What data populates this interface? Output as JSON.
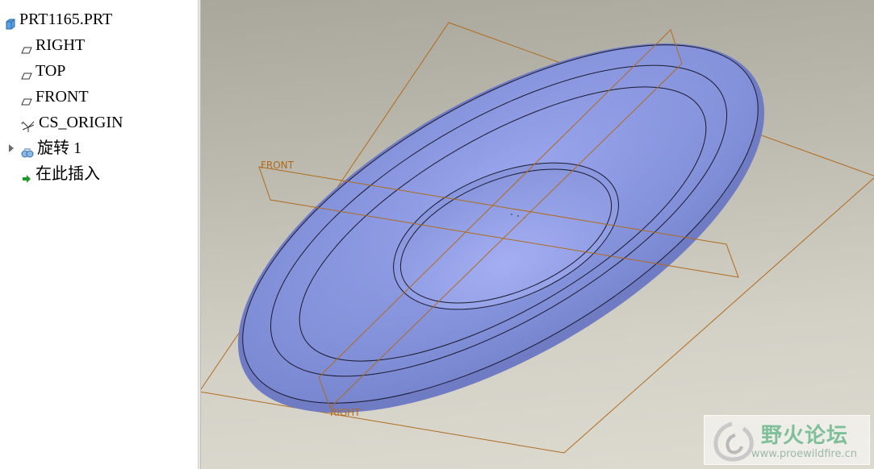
{
  "model_tree": {
    "root": {
      "label": "PRT1165.PRT",
      "icon": "part-icon"
    },
    "items": [
      {
        "label": "RIGHT",
        "icon": "datum-plane-icon"
      },
      {
        "label": "TOP",
        "icon": "datum-plane-icon"
      },
      {
        "label": "FRONT",
        "icon": "datum-plane-icon"
      },
      {
        "label": "CS_ORIGIN",
        "icon": "coordinate-system-icon"
      },
      {
        "label": "旋转 1",
        "icon": "revolve-feature-icon"
      },
      {
        "label": "在此插入",
        "icon": "insert-here-arrow-icon"
      }
    ]
  },
  "viewport": {
    "datum_labels": {
      "front": "FRONT",
      "right": "RIGHT"
    },
    "colors": {
      "datum": "#b06a1c",
      "part_surface": "#8a97de",
      "edges": "#1a1a2e"
    }
  },
  "watermark": {
    "title": "野火论坛",
    "url": "www.proewildfire.cn"
  }
}
